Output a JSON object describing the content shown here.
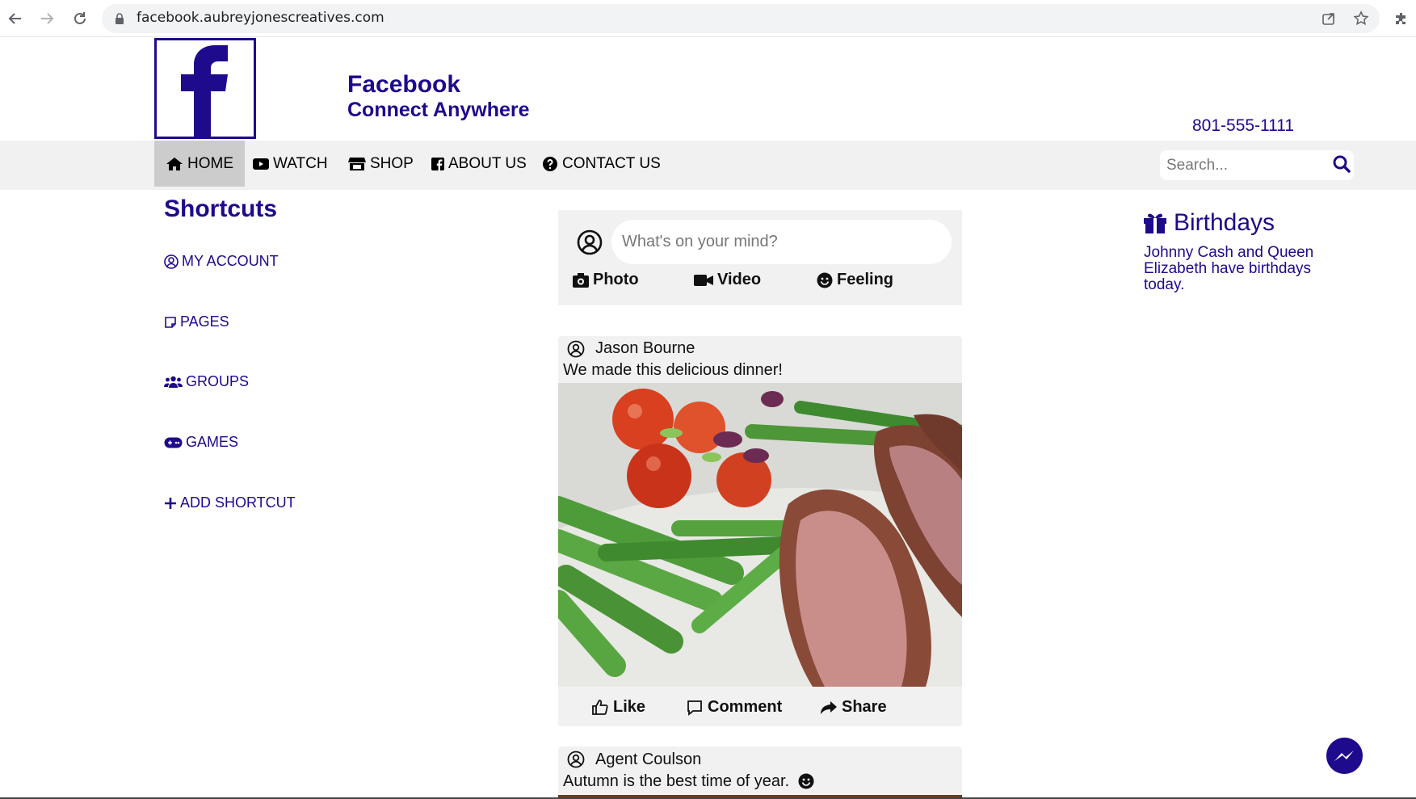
{
  "browser": {
    "url": "facebook.aubreyjonescreatives.com"
  },
  "header": {
    "title": "Facebook",
    "subtitle": "Connect Anywhere",
    "phone": "801-555-1111"
  },
  "nav": {
    "items": [
      {
        "label": "HOME",
        "icon": "home-icon",
        "active": true
      },
      {
        "label": "WATCH",
        "icon": "video-icon"
      },
      {
        "label": "SHOP",
        "icon": "store-icon"
      },
      {
        "label": "ABOUT US",
        "icon": "facebook-square-icon"
      },
      {
        "label": "CONTACT US",
        "icon": "question-circle-icon"
      }
    ],
    "search_placeholder": "Search..."
  },
  "shortcuts": {
    "title": "Shortcuts",
    "items": [
      {
        "label": "MY ACCOUNT",
        "icon": "user-circle-icon"
      },
      {
        "label": "PAGES",
        "icon": "note-icon"
      },
      {
        "label": "GROUPS",
        "icon": "users-icon"
      },
      {
        "label": "GAMES",
        "icon": "gamepad-icon"
      },
      {
        "label": "ADD SHORTCUT",
        "icon": "plus-icon"
      }
    ]
  },
  "composer": {
    "placeholder": "What's on your mind?",
    "actions": [
      {
        "label": "Photo",
        "icon": "camera-icon"
      },
      {
        "label": "Video",
        "icon": "video-camera-icon"
      },
      {
        "label": "Feeling",
        "icon": "smile-icon"
      }
    ]
  },
  "posts": [
    {
      "author": "Jason Bourne",
      "text": "We made this delicious dinner!",
      "image": "steak-asparagus-tomatoes-photo",
      "actions": [
        {
          "label": "Like",
          "icon": "thumbs-up-icon"
        },
        {
          "label": "Comment",
          "icon": "comment-icon"
        },
        {
          "label": "Share",
          "icon": "share-icon"
        }
      ]
    },
    {
      "author": "Agent Coulson",
      "text": "Autumn is the best time of year."
    }
  ],
  "birthdays": {
    "title": "Birthdays",
    "text": "Johnny Cash and Queen Elizabeth have birthdays today."
  },
  "colors": {
    "brand": "#1d0a8c",
    "nav_bg": "#f1f1f1",
    "nav_active": "#cccccc",
    "card_bg": "#f1f1f1"
  }
}
